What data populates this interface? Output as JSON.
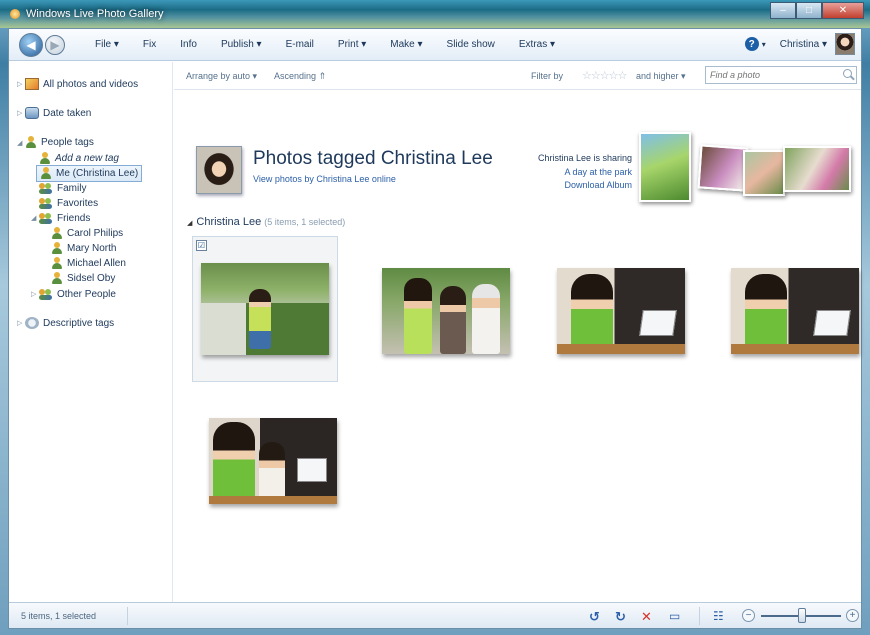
{
  "window": {
    "title": "Windows Live Photo Gallery",
    "controls": {
      "minimize": "–",
      "maximize": "□",
      "close": "✕"
    }
  },
  "toolbar": {
    "back_icon": "back-arrow-icon",
    "forward_icon": "forward-arrow-icon",
    "menu": [
      "File ▾",
      "Fix",
      "Info",
      "Publish ▾",
      "E-mail",
      "Print ▾",
      "Make ▾",
      "Slide show",
      "Extras ▾"
    ],
    "help_label": "?",
    "help_caret": "▾",
    "user_name": "Christina ▾"
  },
  "sidebar": {
    "items": [
      {
        "label": "All photos and videos",
        "icon": "photos-icon",
        "arrow": "▷"
      },
      {
        "label": "Date taken",
        "icon": "calendar-icon",
        "arrow": "▷"
      },
      {
        "label": "People tags",
        "icon": "person-icon",
        "arrow": "◢"
      },
      {
        "label": "Add a new tag",
        "icon": "add-person-icon"
      },
      {
        "label": "Me (Christina Lee)",
        "icon": "person-icon",
        "selected": true
      },
      {
        "label": "Family",
        "icon": "group-icon"
      },
      {
        "label": "Favorites",
        "icon": "group-icon"
      },
      {
        "label": "Friends",
        "icon": "group-icon",
        "arrow": "◢"
      },
      {
        "label": "Carol Philips",
        "icon": "person-icon"
      },
      {
        "label": "Mary North",
        "icon": "person-icon"
      },
      {
        "label": "Michael Allen",
        "icon": "person-icon"
      },
      {
        "label": "Sidsel Oby",
        "icon": "person-icon"
      },
      {
        "label": "Other People",
        "icon": "group-icon",
        "arrow": "▷"
      },
      {
        "label": "Descriptive tags",
        "icon": "tag-icon",
        "arrow": "▷"
      }
    ]
  },
  "subbar": {
    "arrange": "Arrange by auto ▾",
    "order": "Ascending ⇑",
    "filter_label": "Filter by",
    "stars": "☆☆☆☆☆",
    "filter_suffix": "and higher ▾",
    "search_placeholder": "Find a photo"
  },
  "header": {
    "title": "Photos tagged Christina Lee",
    "link": "View photos by Christina Lee online",
    "sharing_text": "Christina Lee is sharing",
    "album_link": "A day at the park",
    "download_link": "Download Album"
  },
  "group": {
    "collapse": "◢",
    "name": "Christina Lee",
    "count": "(5 items, 1 selected)",
    "checkbox": "☑"
  },
  "photos": [
    {
      "scene": "woman-on-path-near-hedge",
      "selected": true
    },
    {
      "scene": "three-women-posing"
    },
    {
      "scene": "woman-with-laptop"
    },
    {
      "scene": "woman-with-laptop"
    },
    {
      "scene": "two-women-at-laptop"
    }
  ],
  "status": {
    "text": "5 items, 1 selected",
    "rotate_left_icon": "rotate-left-icon",
    "rotate_right_icon": "rotate-right-icon",
    "delete_icon": "delete-icon",
    "slideshow_icon": "slideshow-icon",
    "view_icon": "details-view-icon",
    "zoom_minus": "−",
    "zoom_plus": "+",
    "zoom_level": 0.5
  },
  "colors": {
    "accent": "#2b5fa7",
    "text": "#1e395b",
    "delete": "#d7322a"
  }
}
